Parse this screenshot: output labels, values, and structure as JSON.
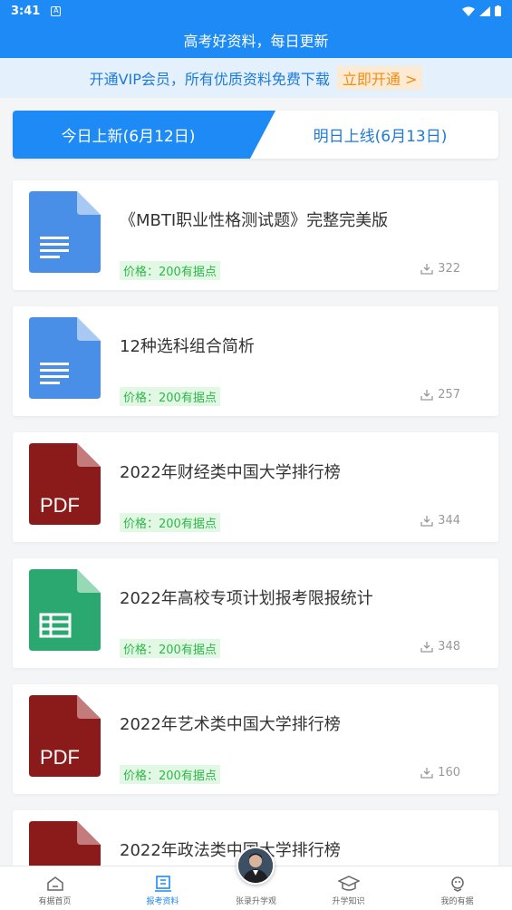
{
  "status": {
    "time": "3:41",
    "notif_glyph": "A"
  },
  "header": {
    "title": "高考好资料，每日更新"
  },
  "vip": {
    "text": "开通VIP会员，所有优质资料免费下载",
    "cta": "立即开通 >"
  },
  "tabs": {
    "today": "今日上新(6月12日)",
    "tomorrow": "明日上线(6月13日)"
  },
  "colors": {
    "primary": "#1d8af5",
    "doc": "#4a8fe7",
    "pdf": "#8b1a1a",
    "sheet": "#2aa86f",
    "price_bg": "#e3f8e4",
    "price_text": "#2db84a"
  },
  "items": [
    {
      "icon": "doc-file-icon",
      "title": "《MBTI职业性格测试题》完整完美版",
      "price": "价格：200有据点",
      "downloads": "322"
    },
    {
      "icon": "doc-file-icon",
      "title": "12种选科组合简析",
      "price": "价格：200有据点",
      "downloads": "257"
    },
    {
      "icon": "pdf-file-icon",
      "title": "2022年财经类中国大学排行榜",
      "price": "价格：200有据点",
      "downloads": "344"
    },
    {
      "icon": "sheet-file-icon",
      "title": "2022年高校专项计划报考限报统计",
      "price": "价格：200有据点",
      "downloads": "348"
    },
    {
      "icon": "pdf-file-icon",
      "title": "2022年艺术类中国大学排行榜",
      "price": "价格：200有据点",
      "downloads": "160"
    },
    {
      "icon": "pdf-file-icon",
      "title": "2022年政法类中国大学排行榜",
      "price": "",
      "downloads": ""
    }
  ],
  "pdf_label": "PDF",
  "nav": [
    {
      "label": "有据首页",
      "icon": "home-icon"
    },
    {
      "label": "报考资料",
      "icon": "book-icon",
      "active": true
    },
    {
      "label": "张录升学观",
      "icon": "avatar"
    },
    {
      "label": "升学知识",
      "icon": "graduation-cap-icon"
    },
    {
      "label": "我的有据",
      "icon": "profile-icon"
    }
  ]
}
